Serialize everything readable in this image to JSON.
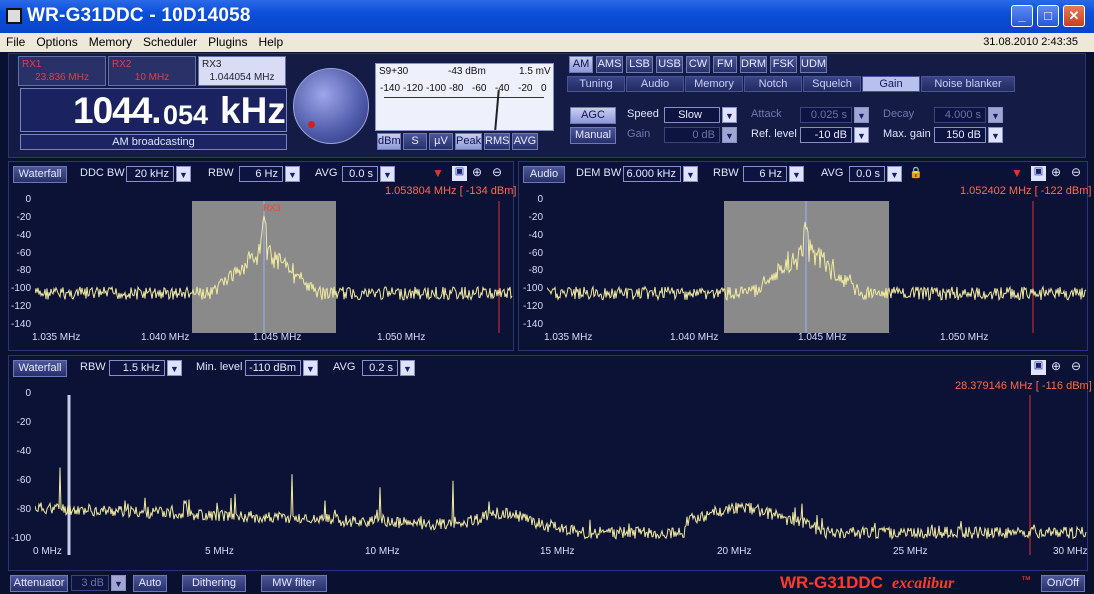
{
  "window": {
    "title": "WR-G31DDC - 10D14058",
    "min": "_",
    "max": "□",
    "close": "✕"
  },
  "menu": {
    "items": [
      "File",
      "Options",
      "Memory",
      "Scheduler",
      "Plugins",
      "Help"
    ],
    "datetime": "31.08.2010 2:43:35"
  },
  "receivers": [
    {
      "name": "RX1",
      "freq": "23.836 MHz"
    },
    {
      "name": "RX2",
      "freq": "10 MHz"
    },
    {
      "name": "RX3",
      "freq": "1.044054 MHz"
    }
  ],
  "frequency": {
    "main": "1044.",
    "small": "054",
    "unit": "kHz",
    "band": "AM broadcasting"
  },
  "smeter": {
    "s_label": "S9+30",
    "dbm": "-43 dBm",
    "uv": "1.5 mV",
    "scale": [
      "-140",
      "-120",
      "-100",
      "-80",
      "-60",
      "-40",
      "-20",
      "0"
    ],
    "buttons": [
      "dBm",
      "S",
      "µV",
      "Peak",
      "RMS",
      "AVG"
    ]
  },
  "modes": [
    "AM",
    "AMS",
    "LSB",
    "USB",
    "CW",
    "FM",
    "DRM",
    "FSK",
    "UDM"
  ],
  "tabs": [
    "Tuning",
    "Audio",
    "Memory",
    "Notch",
    "Squelch",
    "Gain",
    "Noise blanker"
  ],
  "gain": {
    "agc": "AGC",
    "manual": "Manual",
    "speed_label": "Speed",
    "speed": "Slow",
    "gain_label": "Gain",
    "gain": "0 dB",
    "attack_label": "Attack",
    "attack": "0.025 s",
    "ref_label": "Ref. level",
    "ref": "-10 dB",
    "decay_label": "Decay",
    "decay": "4.000 s",
    "maxgain_label": "Max. gain",
    "maxgain": "150 dB"
  },
  "ddc": {
    "view": "Waterfall",
    "bw_label": "DDC BW",
    "bw": "20 kHz",
    "rbw_label": "RBW",
    "rbw": "6 Hz",
    "avg_label": "AVG",
    "avg": "0.0 s",
    "marker": "1.053804 MHz [ -134 dBm]",
    "rx_tag": "RX3",
    "yticks": [
      "0",
      "-20",
      "-40",
      "-60",
      "-80",
      "-100",
      "-120",
      "-140"
    ],
    "xticks": [
      "1.035 MHz",
      "1.040 MHz",
      "1.045 MHz",
      "1.050 MHz"
    ]
  },
  "dem": {
    "view": "Audio",
    "bw_label": "DEM BW",
    "bw": "6.000 kHz",
    "rbw_label": "RBW",
    "rbw": "6 Hz",
    "avg_label": "AVG",
    "avg": "0.0 s",
    "marker": "1.052402 MHz [ -122 dBm]",
    "yticks": [
      "0",
      "-20",
      "-40",
      "-60",
      "-80",
      "-100",
      "-120",
      "-140"
    ],
    "xticks": [
      "1.035 MHz",
      "1.040 MHz",
      "1.045 MHz",
      "1.050 MHz"
    ]
  },
  "wide": {
    "view": "Waterfall",
    "rbw_label": "RBW",
    "rbw": "1.5 kHz",
    "minlevel_label": "Min. level",
    "minlevel": "-110 dBm",
    "avg_label": "AVG",
    "avg": "0.2 s",
    "marker": "28.379146 MHz [ -116 dBm]",
    "yticks": [
      "0",
      "-20",
      "-40",
      "-60",
      "-80",
      "-100"
    ],
    "xticks": [
      "0 MHz",
      "5 MHz",
      "10 MHz",
      "15 MHz",
      "20 MHz",
      "25 MHz",
      "30 MHz"
    ]
  },
  "bottom": {
    "attenuator": "Attenuator",
    "att_value": "3 dB",
    "auto": "Auto",
    "dithering": "Dithering",
    "mwfilter": "MW filter",
    "brand": "WR-G31DDC",
    "brand2": "excalibur",
    "brand_tm": "™",
    "onoff": "On/Off"
  },
  "colors": {
    "trace": "#f0eaa0",
    "marker": "#e03030",
    "passband": "#8a8a8a",
    "accent": "#ff3b2a"
  }
}
